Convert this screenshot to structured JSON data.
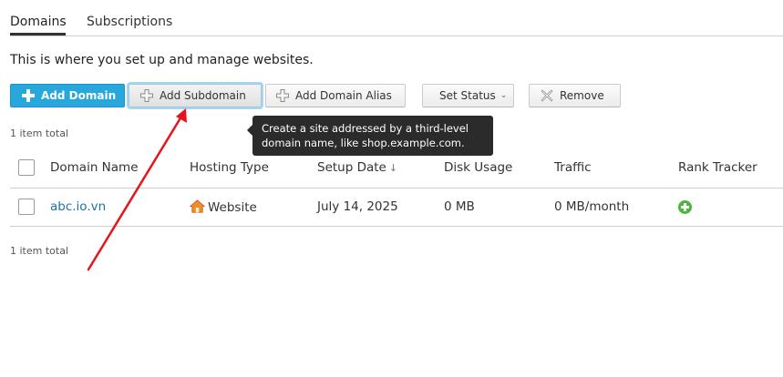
{
  "tabs": [
    {
      "label": "Domains",
      "active": true
    },
    {
      "label": "Subscriptions",
      "active": false
    }
  ],
  "intro_text": "This is where you set up and manage websites.",
  "toolbar": {
    "add_domain": "Add Domain",
    "add_subdomain": "Add Subdomain",
    "add_domain_alias": "Add Domain Alias",
    "set_status": "Set Status",
    "remove": "Remove"
  },
  "tooltip": {
    "line1": "Create a site addressed by a third-level",
    "line2": "domain name, like shop.example.com."
  },
  "item_count_top": "1 item total",
  "item_count_bottom": "1 item total",
  "table": {
    "headers": {
      "domain_name": "Domain Name",
      "hosting_type": "Hosting Type",
      "setup_date": "Setup Date",
      "setup_date_sort": "↓",
      "disk_usage": "Disk Usage",
      "traffic": "Traffic",
      "rank_tracker": "Rank Tracker"
    },
    "rows": [
      {
        "domain": "abc.io.vn",
        "hosting_type": "Website",
        "setup_date": "July 14, 2025",
        "disk_usage": "0 MB",
        "traffic": "0 MB/month"
      }
    ]
  },
  "colors": {
    "primary_button": "#28a7dd",
    "link": "#1a74a3",
    "rank_add": "#47b839",
    "annotation_arrow": "#e8141b",
    "tooltip_bg": "#2b2b2b"
  },
  "icons": {
    "add_domain": "plus-icon",
    "add_subdomain": "plus-outline-icon",
    "add_alias": "plus-outline-icon",
    "set_status_caret": "chevron-down-icon",
    "remove": "x-icon",
    "hosting": "house-icon",
    "rank_tracker": "add-circle-icon"
  }
}
